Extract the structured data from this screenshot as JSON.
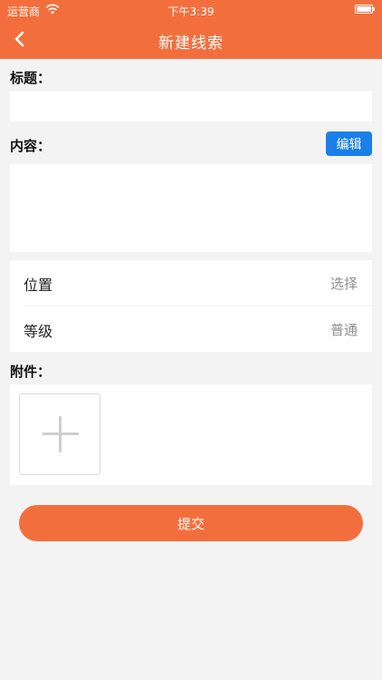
{
  "status_bar": {
    "carrier": "运营商",
    "time": "下午3:39",
    "battery_level": 1.0
  },
  "nav": {
    "title": "新建线索",
    "back_icon": "chevron-left-icon"
  },
  "form": {
    "title_label": "标题：",
    "title_value": "",
    "content_label": "内容：",
    "content_value": "",
    "edit_button": "编辑",
    "location_label": "位置",
    "location_value": "选择",
    "level_label": "等级",
    "level_value": "普通",
    "attachments_label": "附件：",
    "add_attachment_icon": "plus-icon",
    "submit_button": "提交"
  },
  "colors": {
    "brand": "#f26f3d",
    "accent_blue": "#1a7fe8",
    "background": "#f3f3f3"
  }
}
